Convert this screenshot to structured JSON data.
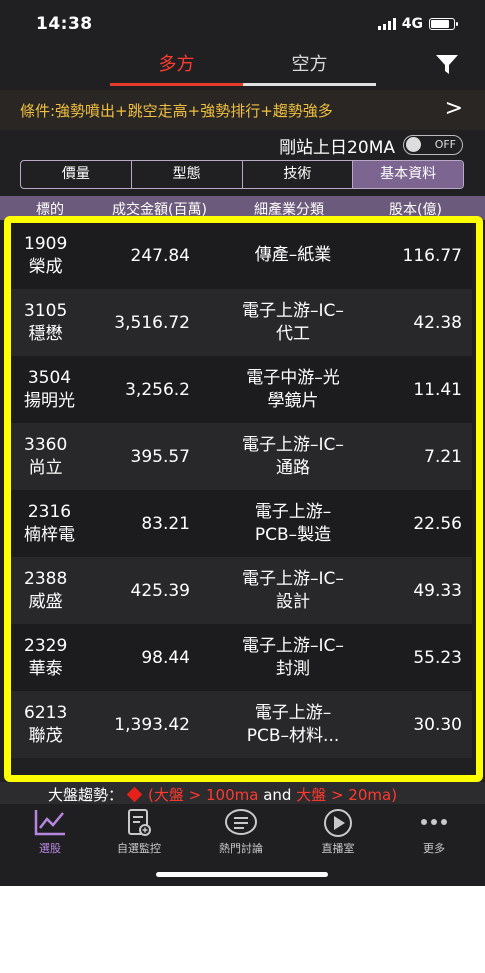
{
  "status": {
    "time": "14:38",
    "network": "4G"
  },
  "top_tabs": [
    {
      "label": "多方",
      "active": true
    },
    {
      "label": "空方",
      "active": false
    }
  ],
  "condition": {
    "text": "條件:強勢噴出+跳空走高+強勢排行+趨勢強多",
    "chevron": ">"
  },
  "ma_switch": {
    "label": "剛站上日20MA",
    "state": "OFF"
  },
  "segments": [
    "價量",
    "型態",
    "技術",
    "基本資料"
  ],
  "active_segment": "基本資料",
  "table": {
    "headers": [
      "標的",
      "成交金額(百萬)",
      "細產業分類",
      "股本(億)"
    ],
    "rows": [
      {
        "code": "1909",
        "name": "榮成",
        "amount": "247.84",
        "industry_1": "傳產–紙業",
        "industry_2": "",
        "capital": "116.77"
      },
      {
        "code": "3105",
        "name": "穩懋",
        "amount": "3,516.72",
        "industry_1": "電子上游–IC–",
        "industry_2": "代工",
        "capital": "42.38"
      },
      {
        "code": "3504",
        "name": "揚明光",
        "amount": "3,256.2",
        "industry_1": "電子中游–光",
        "industry_2": "學鏡片",
        "capital": "11.41"
      },
      {
        "code": "3360",
        "name": "尚立",
        "amount": "395.57",
        "industry_1": "電子上游–IC–",
        "industry_2": "通路",
        "capital": "7.21"
      },
      {
        "code": "2316",
        "name": "楠梓電",
        "amount": "83.21",
        "industry_1": "電子上游–",
        "industry_2": "PCB–製造",
        "capital": "22.56"
      },
      {
        "code": "2388",
        "name": "威盛",
        "amount": "425.39",
        "industry_1": "電子上游–IC–",
        "industry_2": "設計",
        "capital": "49.33"
      },
      {
        "code": "2329",
        "name": "華泰",
        "amount": "98.44",
        "industry_1": "電子上游–IC–",
        "industry_2": "封測",
        "capital": "55.23"
      },
      {
        "code": "6213",
        "name": "聯茂",
        "amount": "1,393.42",
        "industry_1": "電子上游–",
        "industry_2": "PCB–材料...",
        "capital": "30.30"
      }
    ]
  },
  "trend": {
    "label": "大盤趨勢：",
    "cond1_a": "(大盤",
    "cond1_b": " > 100ma",
    "and": " and ",
    "cond2_a": "大盤",
    "cond2_b": " > 20ma)"
  },
  "nav": [
    {
      "label": "選股",
      "icon": "chart-line-icon",
      "active": true
    },
    {
      "label": "自選監控",
      "icon": "watchlist-icon",
      "active": false
    },
    {
      "label": "熱門討論",
      "icon": "chat-bubble-icon",
      "active": false
    },
    {
      "label": "直播室",
      "icon": "play-circle-icon",
      "active": false
    },
    {
      "label": "更多",
      "icon": "more-dots-icon",
      "active": false
    }
  ],
  "colors": {
    "accent_red": "#ff3a2f",
    "condition_text": "#f0c040",
    "purple": "#7c6590",
    "highlight": "#ffff00",
    "nav_active": "#b787e0"
  }
}
